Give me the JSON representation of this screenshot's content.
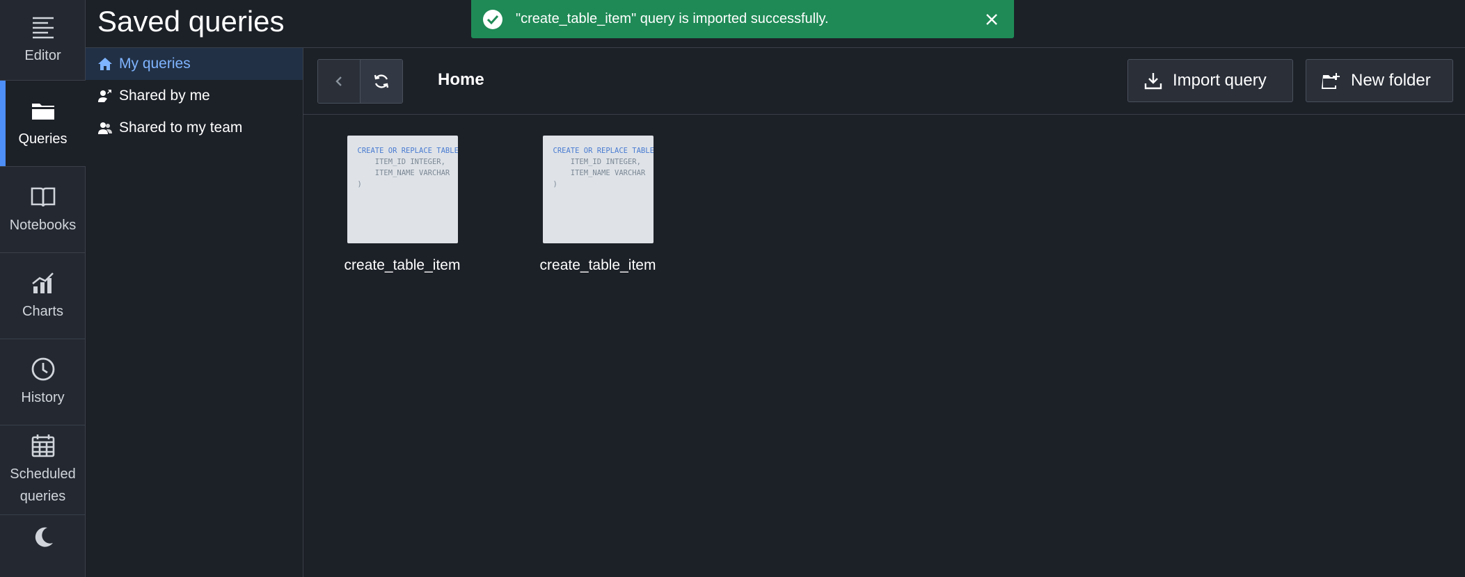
{
  "nav_rail": {
    "items": [
      {
        "label": "Editor",
        "icon": "editor-lines-icon"
      },
      {
        "label": "Queries",
        "icon": "folder-icon",
        "active": true
      },
      {
        "label": "Notebooks",
        "icon": "book-icon"
      },
      {
        "label": "Charts",
        "icon": "chart-icon"
      },
      {
        "label": "History",
        "icon": "clock-icon"
      },
      {
        "label": "Scheduled queries",
        "icon": "calendar-icon"
      }
    ],
    "theme_toggle_icon": "moon-icon"
  },
  "page": {
    "title": "Saved queries"
  },
  "folders": {
    "items": [
      {
        "label": "My queries",
        "icon": "home-icon",
        "active": true
      },
      {
        "label": "Shared by me",
        "icon": "user-share-icon"
      },
      {
        "label": "Shared to my team",
        "icon": "team-icon"
      }
    ]
  },
  "toolbar": {
    "breadcrumb": "Home",
    "import_label": "Import query",
    "new_folder_label": "New folder"
  },
  "queries": [
    {
      "name": "create_table_item",
      "preview": [
        "CREATE OR REPLACE TABLE item (",
        "    ITEM_ID INTEGER,",
        "    ITEM_NAME VARCHAR",
        ")"
      ]
    },
    {
      "name": "create_table_item",
      "preview": [
        "CREATE OR REPLACE TABLE item (",
        "    ITEM_ID INTEGER,",
        "    ITEM_NAME VARCHAR",
        ")"
      ]
    }
  ],
  "toast": {
    "message": "\"create_table_item\" query is imported successfully.",
    "status": "success"
  },
  "colors": {
    "accent": "#4d8ef7",
    "success": "#1f8a56",
    "background": "#1c2027"
  }
}
